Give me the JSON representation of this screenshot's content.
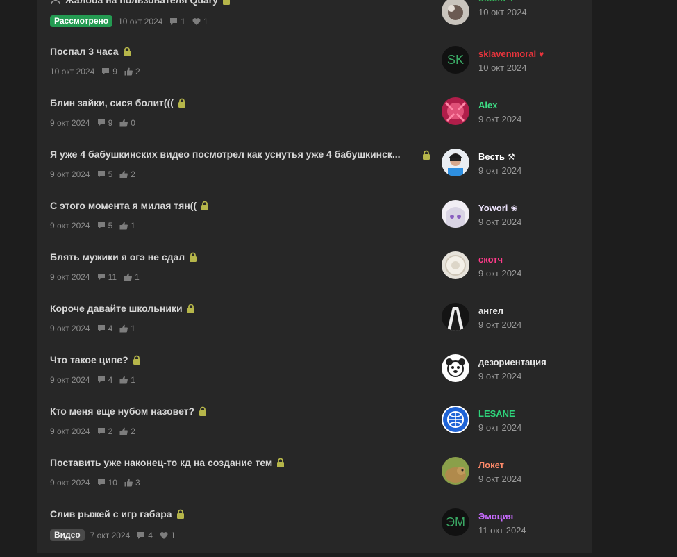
{
  "threads": [
    {
      "title": "Жалоба на пользователя Quary",
      "badge": "Рассмотрено",
      "badge_style": "green",
      "date": "10 окт 2024",
      "comments": "1",
      "likes": "1",
      "like_icon": "heart-icon",
      "title_icon": "user-icon"
    },
    {
      "title": "Поспал 3 часа",
      "date": "10 окт 2024",
      "comments": "9",
      "likes": "2",
      "like_icon": "thumbs-up-icon"
    },
    {
      "title": "Блин зайки, сися болит(((",
      "date": "9 окт 2024",
      "comments": "9",
      "likes": "0",
      "like_icon": "thumbs-up-icon"
    },
    {
      "title": "Я уже 4 бабушкинских видео посмотрел как уснутья уже 4 бабушкинских",
      "display_title": "Я уже 4 бабушкинских видео посмотрел как уснутья уже 4 бабушкинск...",
      "date": "9 окт 2024",
      "comments": "5",
      "likes": "2",
      "like_icon": "thumbs-up-icon"
    },
    {
      "title": "С этого момента я милая тян((",
      "date": "9 окт 2024",
      "comments": "5",
      "likes": "1",
      "like_icon": "thumbs-up-icon"
    },
    {
      "title": "Блять мужики я огэ не сдал",
      "date": "9 окт 2024",
      "comments": "11",
      "likes": "1",
      "like_icon": "thumbs-up-icon"
    },
    {
      "title": "Короче давайте школьники",
      "date": "9 окт 2024",
      "comments": "4",
      "likes": "1",
      "like_icon": "thumbs-up-icon"
    },
    {
      "title": "Что такое ципе?",
      "date": "9 окт 2024",
      "comments": "4",
      "likes": "1",
      "like_icon": "thumbs-up-icon"
    },
    {
      "title": "Кто меня еще нубом назовет?",
      "date": "9 окт 2024",
      "comments": "2",
      "likes": "2",
      "like_icon": "thumbs-up-icon"
    },
    {
      "title": "Поставить уже наконец-то кд на создание тем",
      "date": "9 окт 2024",
      "comments": "10",
      "likes": "3",
      "like_icon": "thumbs-up-icon"
    },
    {
      "title": "Слив рыжей с игр габара",
      "badge": "Видео",
      "badge_style": "gray",
      "date": "7 окт 2024",
      "comments": "4",
      "likes": "1",
      "like_icon": "heart-icon"
    }
  ],
  "users": [
    {
      "name": "bloom",
      "date": "10 окт 2024",
      "color": "#35b35a",
      "icon": "✈"
    },
    {
      "name": "sklavenmoral",
      "date": "10 окт 2024",
      "color": "#e8343c",
      "avatar_text": "SK",
      "avatar_color": "#3aa864",
      "icon": "♥"
    },
    {
      "name": "Alex",
      "date": "9 окт 2024",
      "color": "#3ddc84"
    },
    {
      "name": "Весть",
      "date": "9 окт 2024",
      "color": "#ffffff",
      "icon": "⚒"
    },
    {
      "name": "Yowori",
      "date": "9 окт 2024",
      "color": "#f0e6ff",
      "icon": "❀"
    },
    {
      "name": "скотч",
      "date": "9 окт 2024",
      "color": "#ff3b8a"
    },
    {
      "name": "ангел",
      "date": "9 окт 2024",
      "color": "#e8e8e8"
    },
    {
      "name": "дезориентация",
      "date": "9 окт 2024",
      "color": "#e8e8e8"
    },
    {
      "name": "LESANE",
      "date": "9 окт 2024",
      "color": "#2ed27a"
    },
    {
      "name": "Локет",
      "date": "9 окт 2024",
      "color": "#ff8a6a"
    },
    {
      "name": "Эмоция",
      "date": "11 окт 2024",
      "color": "#c86bff",
      "avatar_text": "ЭМ",
      "avatar_color": "#3aa864"
    }
  ],
  "colors": {
    "lock": "#b6b64a",
    "background": "#1d1d1d",
    "panel": "#272727"
  }
}
